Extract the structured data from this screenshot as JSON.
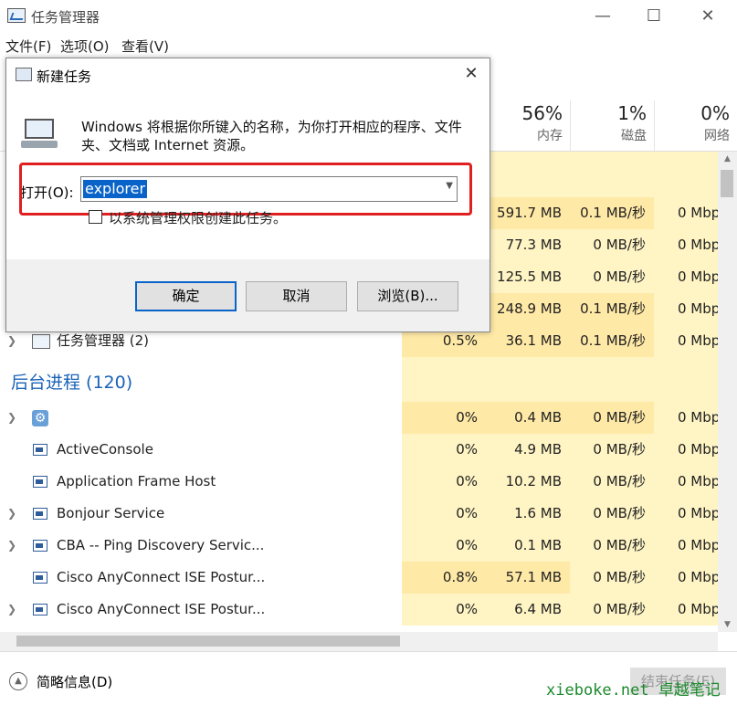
{
  "window": {
    "title": "任务管理器",
    "min": "—",
    "max": "☐",
    "close": "✕"
  },
  "menu": {
    "file": "文件(F)",
    "options": "选项(O)",
    "view": "查看(V)"
  },
  "columns": [
    {
      "pct": "56%",
      "label": "内存"
    },
    {
      "pct": "1%",
      "label": "磁盘"
    },
    {
      "pct": "0%",
      "label": "网络"
    }
  ],
  "app_rows": [
    {
      "mem": "591.7 MB",
      "disk": "0.1 MB/秒",
      "net": "0 Mbps"
    },
    {
      "mem": "77.3 MB",
      "disk": "0 MB/秒",
      "net": "0 Mbps"
    },
    {
      "mem": "125.5 MB",
      "disk": "0 MB/秒",
      "net": "0 Mbps"
    },
    {
      "mem": "248.9 MB",
      "disk": "0.1 MB/秒",
      "net": "0 Mbps"
    },
    {
      "name": "任务管理器 (2)",
      "cpu": "0.5%",
      "mem": "36.1 MB",
      "disk": "0.1 MB/秒",
      "net": "0 Mbps"
    }
  ],
  "background_group": "后台进程 (120)",
  "bg_rows": [
    {
      "name": "",
      "cpu": "0%",
      "mem": "0.4 MB",
      "disk": "0 MB/秒",
      "net": "0 Mbps"
    },
    {
      "name": "ActiveConsole",
      "cpu": "0%",
      "mem": "4.9 MB",
      "disk": "0 MB/秒",
      "net": "0 Mbps"
    },
    {
      "name": "Application Frame Host",
      "cpu": "0%",
      "mem": "10.2 MB",
      "disk": "0 MB/秒",
      "net": "0 Mbps"
    },
    {
      "name": "Bonjour Service",
      "cpu": "0%",
      "mem": "1.6 MB",
      "disk": "0 MB/秒",
      "net": "0 Mbps"
    },
    {
      "name": "CBA -- Ping Discovery Servic...",
      "cpu": "0%",
      "mem": "0.1 MB",
      "disk": "0 MB/秒",
      "net": "0 Mbps"
    },
    {
      "name": "Cisco AnyConnect ISE Postur...",
      "cpu": "0.8%",
      "mem": "57.1 MB",
      "disk": "0 MB/秒",
      "net": "0 Mbps"
    },
    {
      "name": "Cisco AnyConnect ISE Postur...",
      "cpu": "0%",
      "mem": "6.4 MB",
      "disk": "0 MB/秒",
      "net": "0 Mbps"
    }
  ],
  "footer": {
    "fewer_details": "简略信息(D)",
    "end_task": "结束任务(E)",
    "watermark": "xieboke.net 卓越笔记"
  },
  "dialog": {
    "title": "新建任务",
    "description": "Windows 将根据你所键入的名称，为你打开相应的程序、文件夹、文档或 Internet 资源。",
    "open_label": "打开(O):",
    "open_value": "explorer",
    "admin_label": "以系统管理权限创建此任务。",
    "ok": "确定",
    "cancel": "取消",
    "browse": "浏览(B)..."
  }
}
